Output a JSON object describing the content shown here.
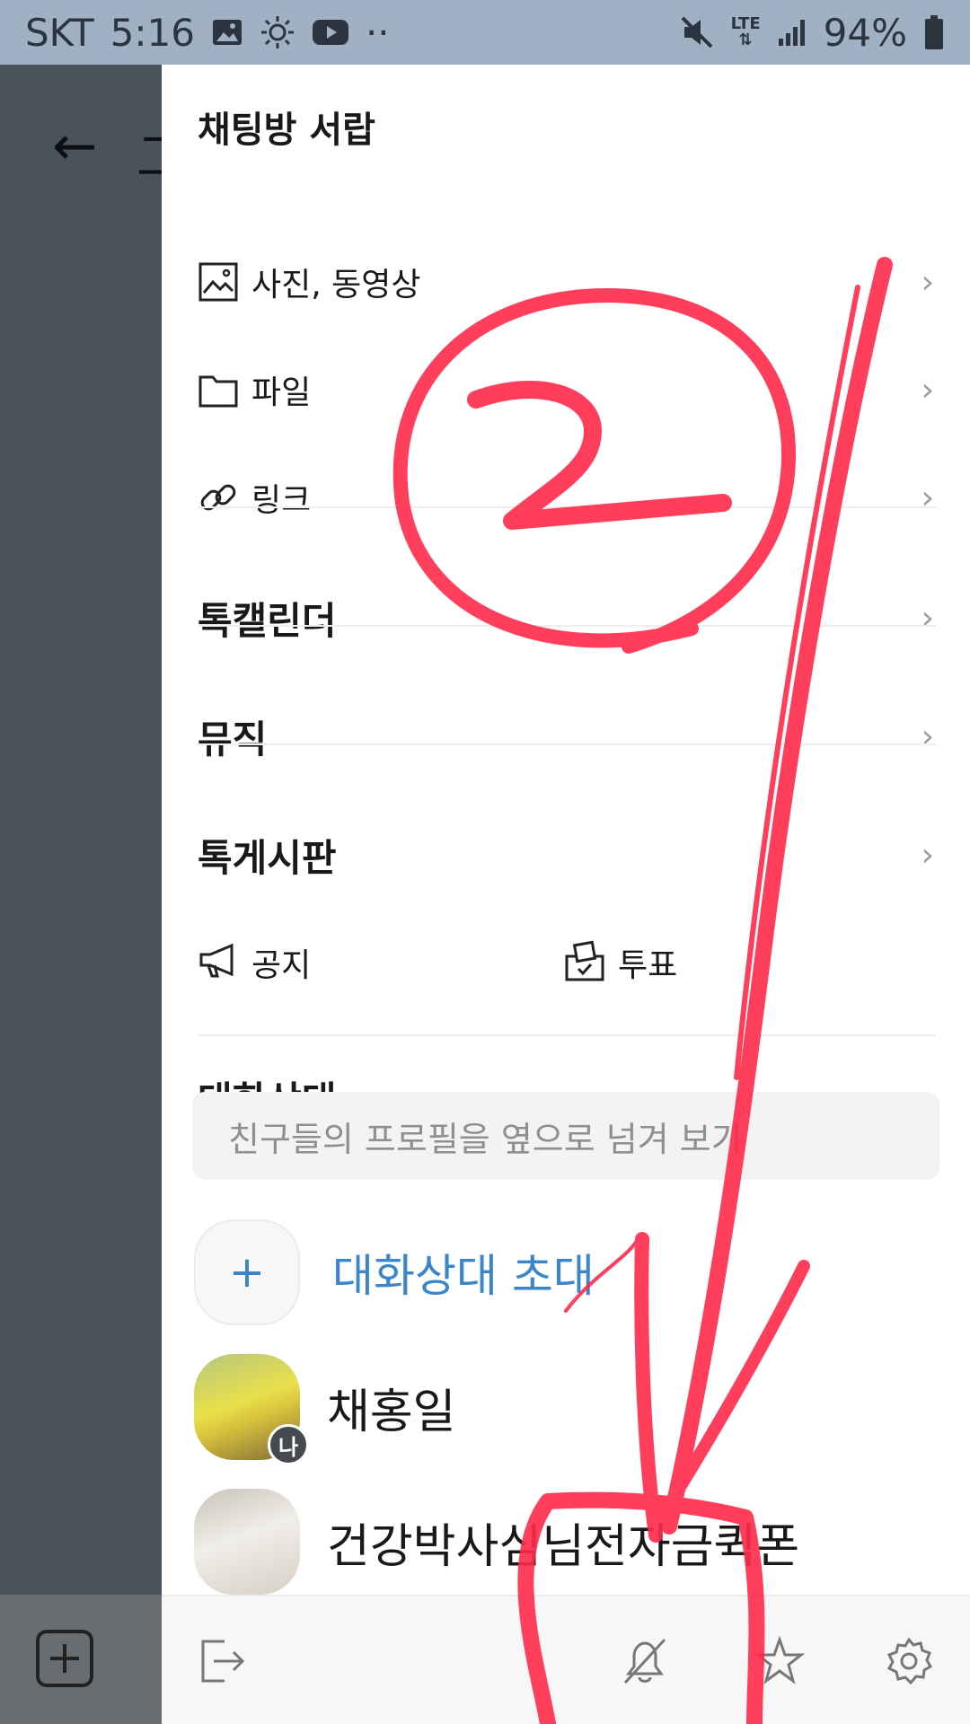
{
  "status_bar": {
    "carrier": "SKT",
    "time": "5:16",
    "dots": "··",
    "network": "LTE",
    "battery": "94%"
  },
  "background": {
    "back_symbol": "←",
    "title_partial": "그"
  },
  "drawer": {
    "title": "채팅방 서랍",
    "items": [
      {
        "label": "사진, 동영상",
        "icon": "image-icon"
      },
      {
        "label": "파일",
        "icon": "folder-icon"
      },
      {
        "label": "링크",
        "icon": "link-icon"
      }
    ],
    "sections": [
      {
        "label": "톡캘린더"
      },
      {
        "label": "뮤직"
      },
      {
        "label": "톡게시판"
      }
    ],
    "notice_label": "공지",
    "vote_label": "투표",
    "chevron": "›"
  },
  "members": {
    "section_title": "대화상대",
    "search_placeholder": "친구들의 프로필을 옆으로 넘겨 보기",
    "invite_label": "대화상대 초대",
    "invite_symbol": "+",
    "list": [
      {
        "name": "채홍일",
        "badge": "나"
      },
      {
        "name": "건강박사심님전자금퀵폰"
      }
    ]
  },
  "bottom_bar": {
    "icons": [
      "exit-icon",
      "bell-off-icon",
      "star-icon",
      "gear-icon"
    ]
  },
  "colors": {
    "accent": "#3a86c8",
    "status_bar": "#9fb1c3",
    "annotation": "#ff2a4a"
  }
}
